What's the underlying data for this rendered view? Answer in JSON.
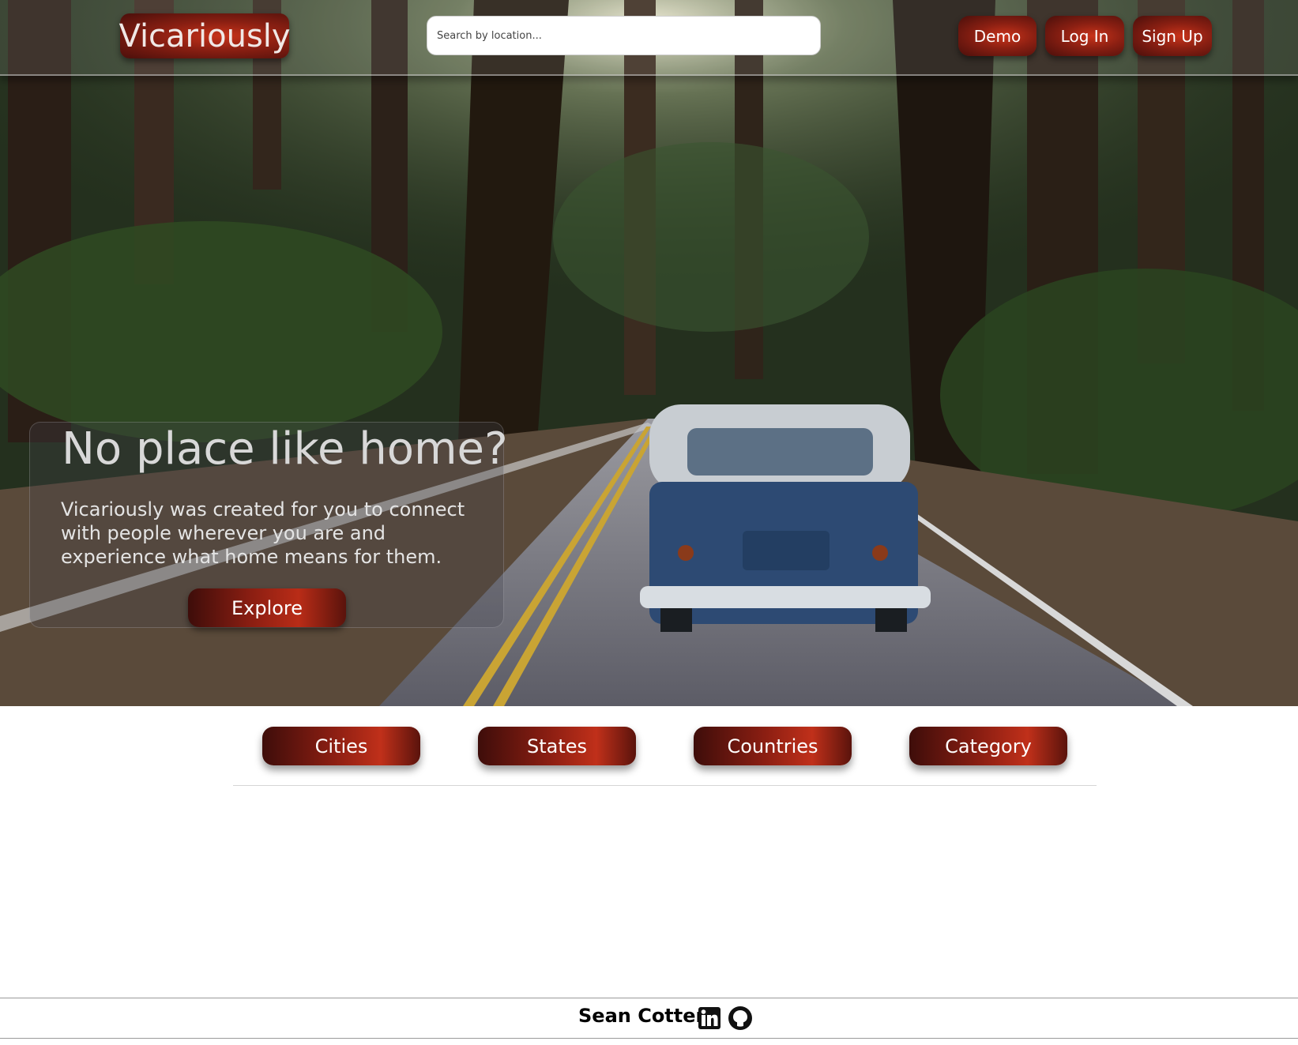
{
  "header": {
    "logo": "Vicariously",
    "search_placeholder": "Search by location...",
    "demo_label": "Demo",
    "login_label": "Log In",
    "signup_label": "Sign Up"
  },
  "hero": {
    "heading": "No place like home?",
    "text": "Vicariously was created for you to connect with people wherever you are and experience what home means for them.",
    "explore_label": "Explore"
  },
  "categories": {
    "cities": "Cities",
    "states": "States",
    "countries": "Countries",
    "category": "Category"
  },
  "footer": {
    "name": "Sean Cotter",
    "icons": [
      "linkedin-icon",
      "github-icon"
    ]
  },
  "colors": {
    "accent": "#8b1e12",
    "accent_dark": "#3e0d0a"
  }
}
